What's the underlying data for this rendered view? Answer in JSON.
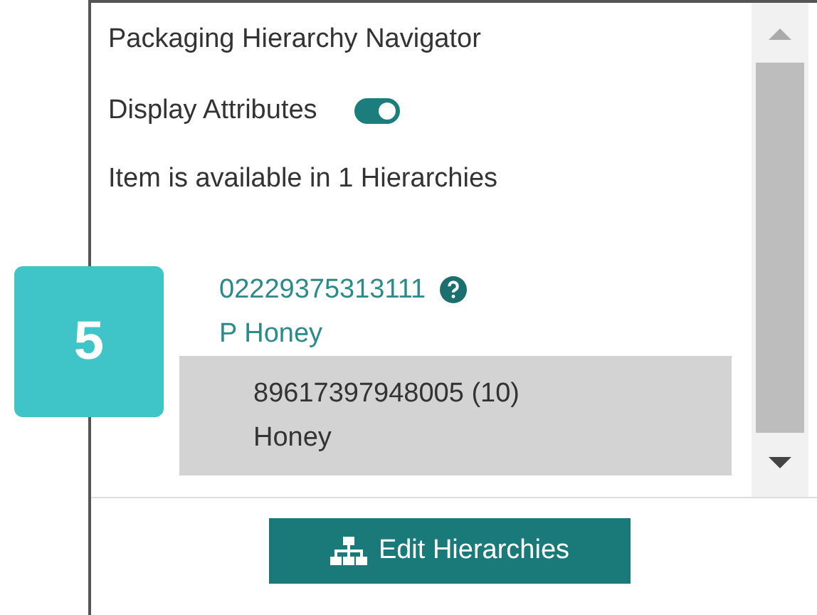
{
  "step_badge": "5",
  "panel": {
    "title": "Packaging Hierarchy Navigator",
    "display_attributes": {
      "label": "Display Attributes",
      "on": true
    },
    "availability": "Item is available in 1 Hierarchies",
    "tree": [
      {
        "code": "02229375313111",
        "name": "P Honey",
        "selected": false,
        "children": [
          {
            "code": "89617397948005 (10)",
            "name": "Honey",
            "selected": true
          }
        ]
      }
    ],
    "button": "Edit Hierarchies"
  }
}
